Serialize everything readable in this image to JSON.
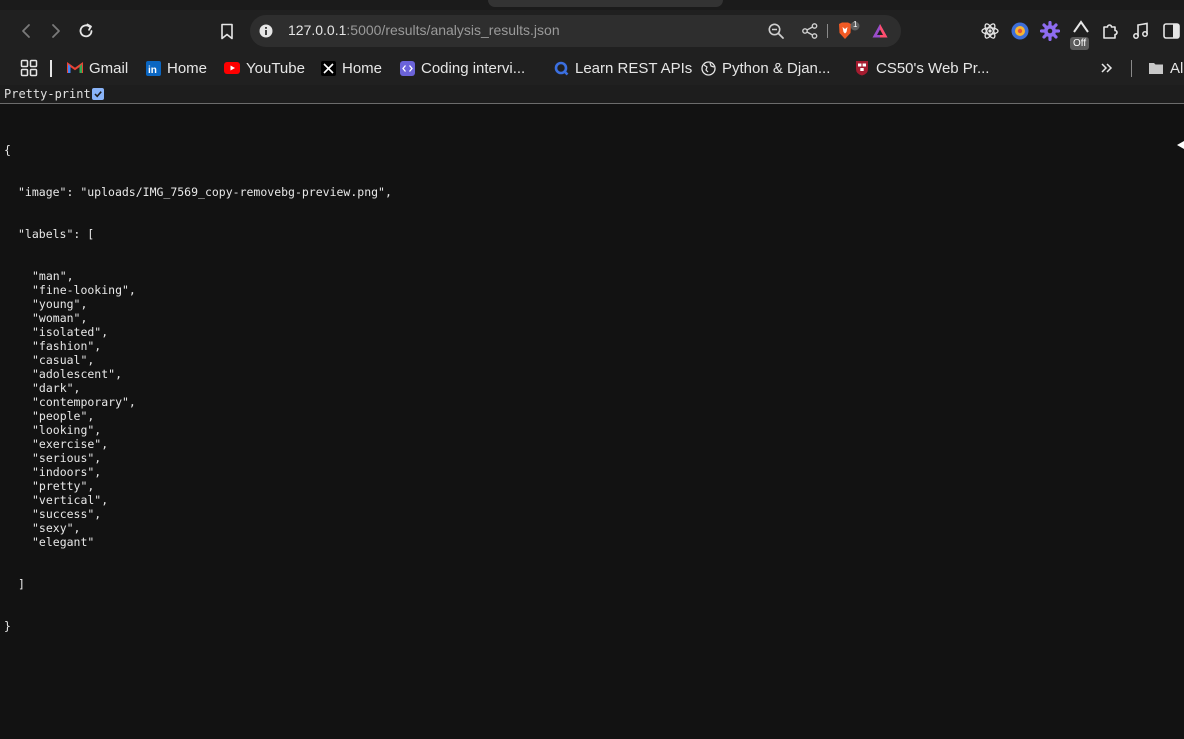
{
  "browser": {
    "url_host": "127.0.0.1",
    "url_path": ":5000/results/analysis_results.json",
    "shields_count": "1",
    "extension_badge": "Off"
  },
  "bookmarks": [
    {
      "label": "Gmail",
      "icon": "gmail-icon"
    },
    {
      "label": "Home",
      "icon": "linkedin-icon"
    },
    {
      "label": "YouTube",
      "icon": "youtube-icon"
    },
    {
      "label": "Home",
      "icon": "x-icon"
    },
    {
      "label": "Coding intervi...",
      "icon": "code-icon"
    },
    {
      "label": "Learn REST APIs",
      "icon": "rest-icon"
    },
    {
      "label": "Python & Djan...",
      "icon": "globe-icon"
    },
    {
      "label": "CS50's Web Pr...",
      "icon": "harvard-icon"
    },
    {
      "label": "Al",
      "icon": "folder-icon"
    }
  ],
  "pretty_print": {
    "label": "Pretty-print",
    "checked": true
  },
  "json_view": {
    "open_brace": "{",
    "image_key": "\"image\"",
    "image_value": "\"uploads/IMG_7569_copy-removebg-preview.png\"",
    "labels_key": "\"labels\"",
    "labels": [
      "man",
      "fine-looking",
      "young",
      "woman",
      "isolated",
      "fashion",
      "casual",
      "adolescent",
      "dark",
      "contemporary",
      "people",
      "looking",
      "exercise",
      "serious",
      "indoors",
      "pretty",
      "vertical",
      "success",
      "sexy",
      "elegant"
    ],
    "close_bracket": "]",
    "close_brace": "}"
  },
  "colors": {
    "background": "#121212",
    "toolbar": "#202020",
    "omnibox": "#2e2e2e",
    "accent": "#8ab4f8"
  }
}
